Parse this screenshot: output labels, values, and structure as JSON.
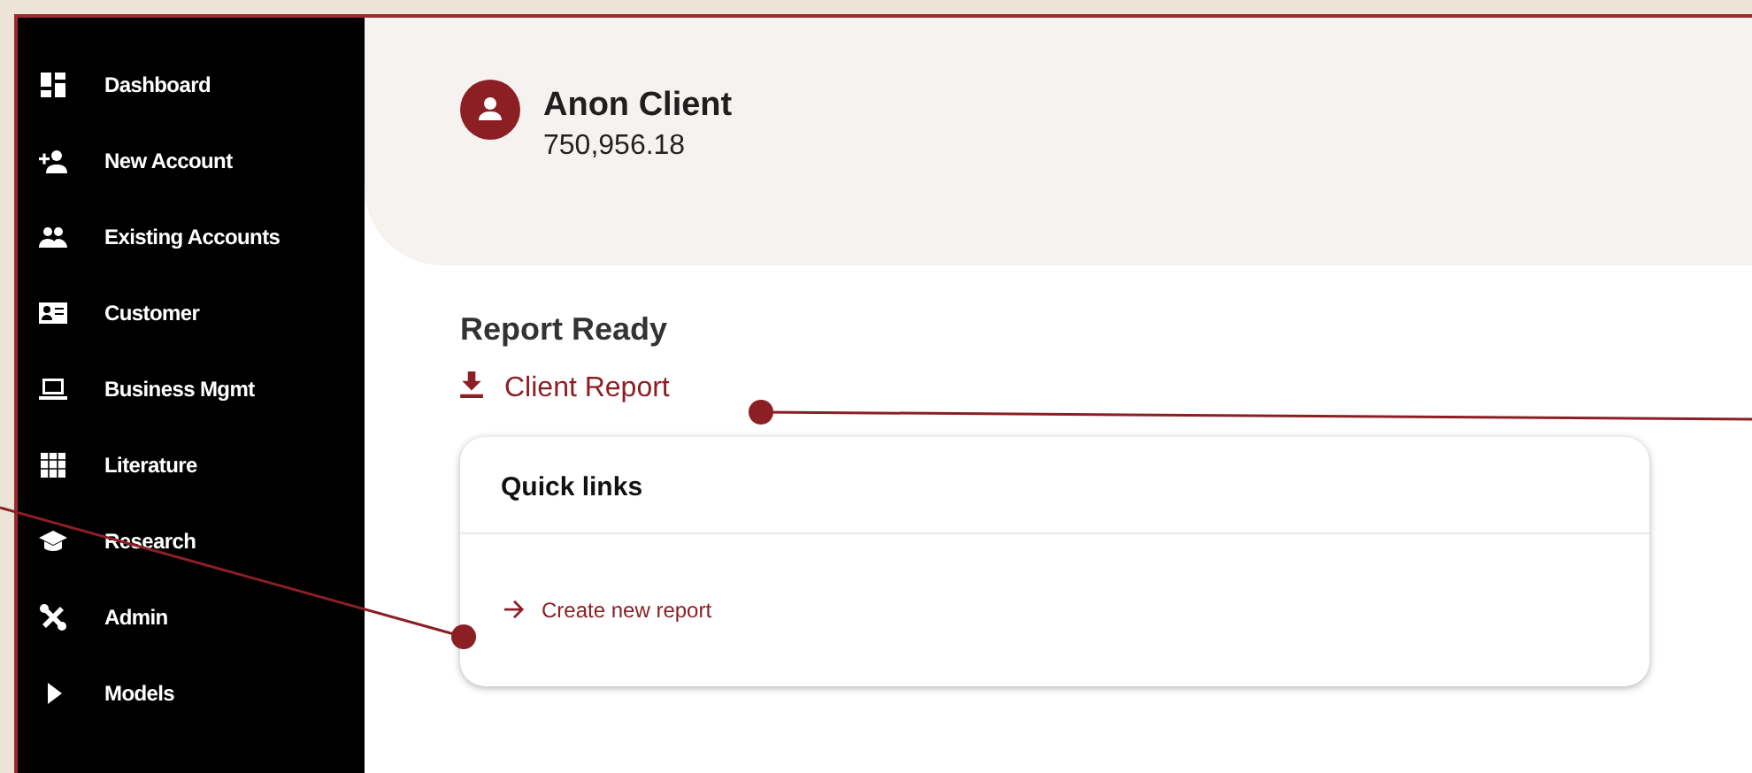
{
  "sidebar": {
    "items": [
      {
        "label": "Dashboard"
      },
      {
        "label": "New Account"
      },
      {
        "label": "Existing Accounts"
      },
      {
        "label": "Customer"
      },
      {
        "label": "Business Mgmt"
      },
      {
        "label": "Literature"
      },
      {
        "label": "Research"
      },
      {
        "label": "Admin"
      },
      {
        "label": "Models"
      }
    ]
  },
  "client": {
    "name": "Anon Client",
    "balance": "750,956.18"
  },
  "report": {
    "heading": "Report Ready",
    "link": "Client Report"
  },
  "quick_links": {
    "title": "Quick links",
    "links": [
      "Create new report"
    ]
  }
}
